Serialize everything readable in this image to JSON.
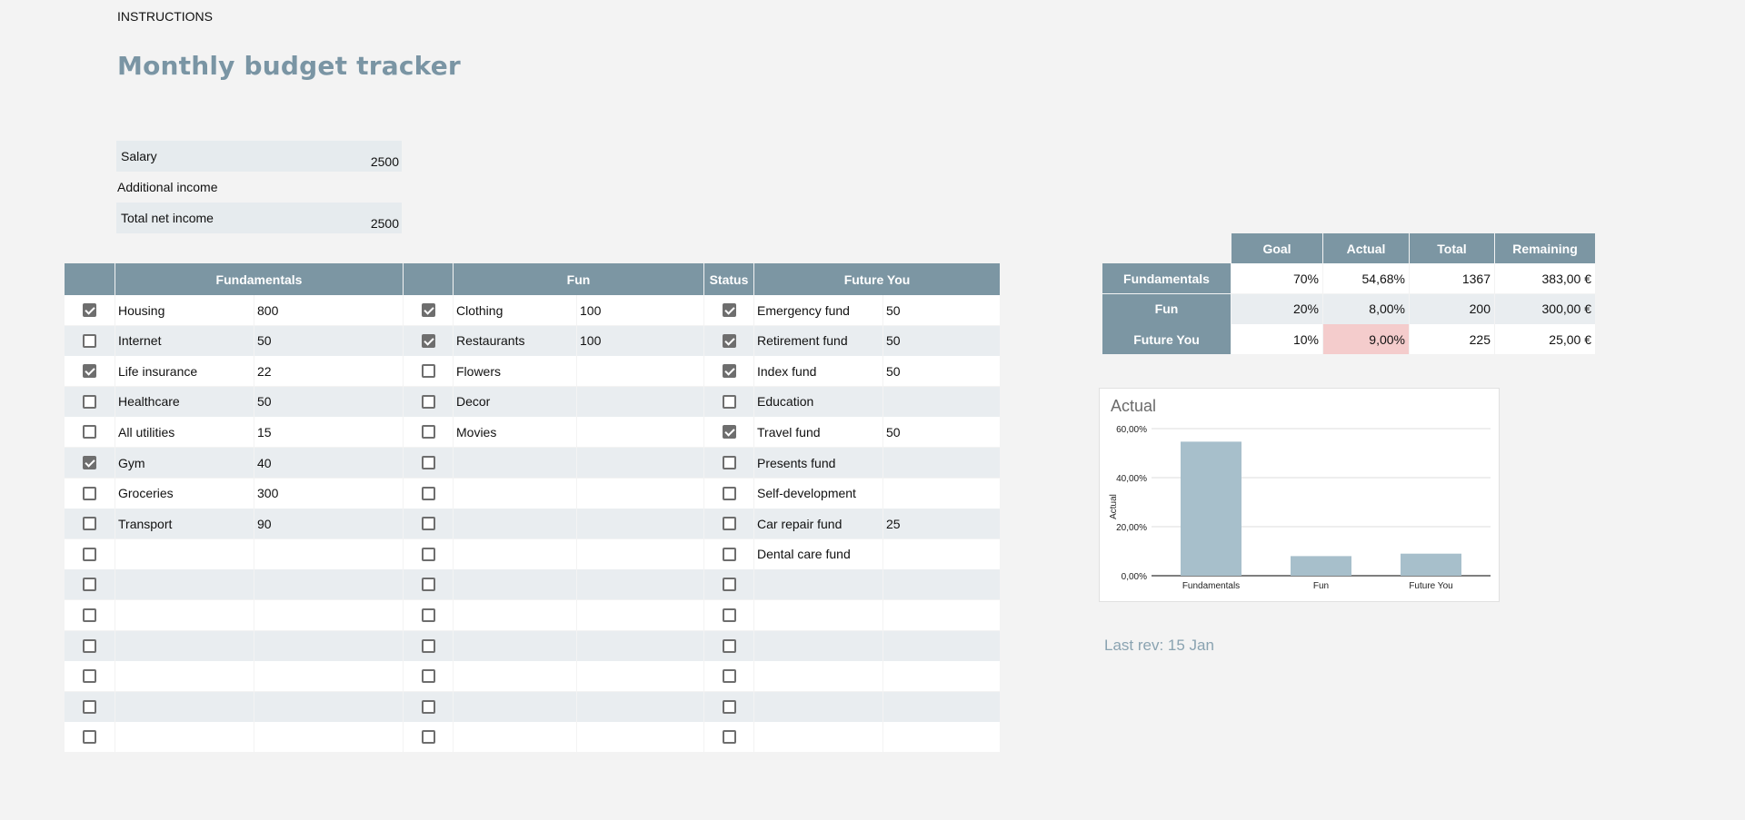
{
  "header": {
    "instructions": "INSTRUCTIONS",
    "title": "Monthly budget tracker"
  },
  "income": [
    {
      "label": "Salary",
      "value": "2500"
    },
    {
      "label": "Additional income",
      "value": ""
    },
    {
      "label": "Total net income",
      "value": "2500"
    }
  ],
  "table": {
    "headers": {
      "fundamentals": "Fundamentals",
      "fun": "Fun",
      "status": "Status",
      "future": "Future You"
    },
    "rows": [
      {
        "f_check": true,
        "f_name": "Housing",
        "f_val": "800",
        "g_check": true,
        "g_name": "Clothing",
        "g_val": "100",
        "s_check": true,
        "y_name": "Emergency fund",
        "y_val": "50"
      },
      {
        "f_check": false,
        "f_name": "Internet",
        "f_val": "50",
        "g_check": true,
        "g_name": "Restaurants",
        "g_val": "100",
        "s_check": true,
        "y_name": "Retirement fund",
        "y_val": "50"
      },
      {
        "f_check": true,
        "f_name": "Life insurance",
        "f_val": "22",
        "g_check": false,
        "g_name": "Flowers",
        "g_val": "",
        "s_check": true,
        "y_name": "Index fund",
        "y_val": "50"
      },
      {
        "f_check": false,
        "f_name": "Healthcare",
        "f_val": "50",
        "g_check": false,
        "g_name": "Decor",
        "g_val": "",
        "s_check": false,
        "y_name": "Education",
        "y_val": ""
      },
      {
        "f_check": false,
        "f_name": "All utilities",
        "f_val": "15",
        "g_check": false,
        "g_name": "Movies",
        "g_val": "",
        "s_check": true,
        "y_name": "Travel fund",
        "y_val": "50"
      },
      {
        "f_check": true,
        "f_name": "Gym",
        "f_val": "40",
        "g_check": false,
        "g_name": "",
        "g_val": "",
        "s_check": false,
        "y_name": "Presents fund",
        "y_val": ""
      },
      {
        "f_check": false,
        "f_name": "Groceries",
        "f_val": "300",
        "g_check": false,
        "g_name": "",
        "g_val": "",
        "s_check": false,
        "y_name": "Self-development",
        "y_val": ""
      },
      {
        "f_check": false,
        "f_name": "Transport",
        "f_val": "90",
        "g_check": false,
        "g_name": "",
        "g_val": "",
        "s_check": false,
        "y_name": "Car repair fund",
        "y_val": "25"
      },
      {
        "f_check": false,
        "f_name": "",
        "f_val": "",
        "g_check": false,
        "g_name": "",
        "g_val": "",
        "s_check": false,
        "y_name": "Dental care fund",
        "y_val": ""
      },
      {
        "f_check": false,
        "f_name": "",
        "f_val": "",
        "g_check": false,
        "g_name": "",
        "g_val": "",
        "s_check": false,
        "y_name": "",
        "y_val": ""
      },
      {
        "f_check": false,
        "f_name": "",
        "f_val": "",
        "g_check": false,
        "g_name": "",
        "g_val": "",
        "s_check": false,
        "y_name": "",
        "y_val": ""
      },
      {
        "f_check": false,
        "f_name": "",
        "f_val": "",
        "g_check": false,
        "g_name": "",
        "g_val": "",
        "s_check": false,
        "y_name": "",
        "y_val": ""
      },
      {
        "f_check": false,
        "f_name": "",
        "f_val": "",
        "g_check": false,
        "g_name": "",
        "g_val": "",
        "s_check": false,
        "y_name": "",
        "y_val": ""
      },
      {
        "f_check": false,
        "f_name": "",
        "f_val": "",
        "g_check": false,
        "g_name": "",
        "g_val": "",
        "s_check": false,
        "y_name": "",
        "y_val": ""
      },
      {
        "f_check": false,
        "f_name": "",
        "f_val": "",
        "g_check": false,
        "g_name": "",
        "g_val": "",
        "s_check": false,
        "y_name": "",
        "y_val": ""
      }
    ]
  },
  "summary": {
    "headers": [
      "Goal",
      "Actual",
      "Total",
      "Remaining"
    ],
    "rows": [
      {
        "label": "Fundamentals",
        "goal": "70%",
        "actual": "54,68%",
        "total": "1367",
        "remaining": "383,00 €",
        "flag": false
      },
      {
        "label": "Fun",
        "goal": "20%",
        "actual": "8,00%",
        "total": "200",
        "remaining": "300,00 €",
        "flag": false
      },
      {
        "label": "Future You",
        "goal": "10%",
        "actual": "9,00%",
        "total": "225",
        "remaining": "25,00 €",
        "flag": true
      }
    ],
    "flag_color": "#f4cccc"
  },
  "chart_data": {
    "type": "bar",
    "title": "Actual",
    "ylabel": "Actual",
    "xlabel": "",
    "categories": [
      "Fundamentals",
      "Fun",
      "Future You"
    ],
    "values": [
      54.68,
      8.0,
      9.0
    ],
    "ylim": [
      0,
      60
    ],
    "yticks": [
      "0,00%",
      "20,00%",
      "40,00%",
      "60,00%"
    ],
    "ytick_values": [
      0,
      20,
      40,
      60
    ],
    "bar_color": "#a7bfcb",
    "grid": true,
    "legend": "none"
  },
  "footer": {
    "last_rev": "Last rev: 15 Jan"
  }
}
